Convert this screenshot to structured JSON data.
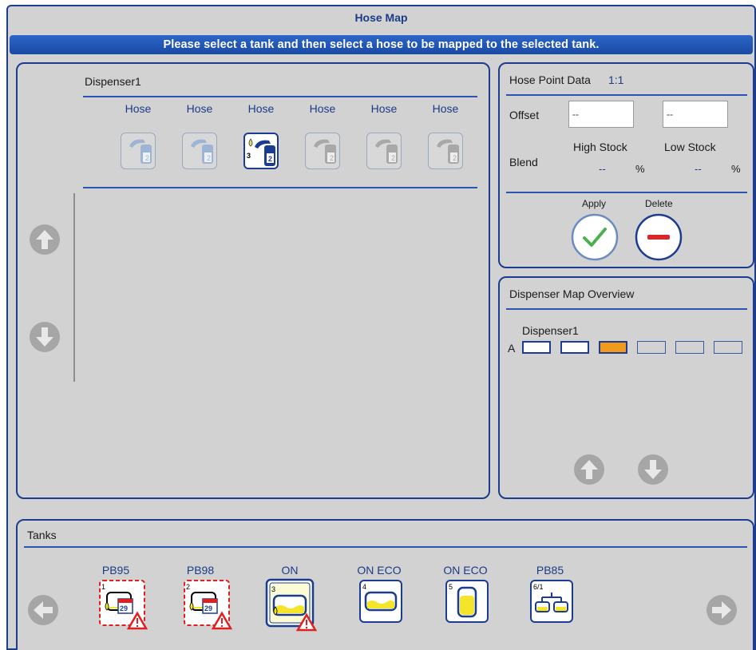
{
  "window": {
    "title": "Hose Map",
    "instruction": "Please select a tank and then select a hose to be mapped to the selected tank."
  },
  "dispenser_panel": {
    "dispenser_name": "Dispenser1",
    "hoses": [
      {
        "label": "Hose",
        "selected": false
      },
      {
        "label": "Hose",
        "selected": false
      },
      {
        "label": "Hose",
        "selected": true,
        "tank_number": "3"
      },
      {
        "label": "Hose",
        "selected": false
      },
      {
        "label": "Hose",
        "selected": false
      },
      {
        "label": "Hose",
        "selected": false
      }
    ]
  },
  "hose_point_data": {
    "title": "Hose Point Data",
    "value": "1:1",
    "offset_label": "Offset",
    "offset_value_1": "--",
    "offset_value_2": "--",
    "blend_label": "Blend",
    "high_stock_label": "High Stock",
    "low_stock_label": "Low Stock",
    "high_stock_value": "--",
    "low_stock_value": "--",
    "percent": "%",
    "apply_label": "Apply",
    "delete_label": "Delete"
  },
  "dispenser_map_overview": {
    "title": "Dispenser Map Overview",
    "dispenser_name": "Dispenser1",
    "row_label": "A",
    "slots": [
      "mapped",
      "mapped",
      "selected",
      "empty",
      "empty",
      "empty"
    ]
  },
  "tanks": {
    "title": "Tanks",
    "items": [
      {
        "label": "PB95",
        "number": "1",
        "date": "29",
        "warning": true
      },
      {
        "label": "PB98",
        "number": "2",
        "date": "29",
        "warning": true
      },
      {
        "label": "ON",
        "number": "3",
        "warning": true,
        "selected": true
      },
      {
        "label": "ON  ECO",
        "number": "4"
      },
      {
        "label": "ON  ECO",
        "number": "5"
      },
      {
        "label": "PB85",
        "number": "6/1"
      }
    ]
  },
  "colors": {
    "accent": "#1c3d8f",
    "banner": "#2c66c8",
    "background": "#d2d2d2",
    "selected_slot": "#f29a1c",
    "warning": "#e02020",
    "fuel": "#f5e52a",
    "apply": "#4caf50",
    "delete": "#d9262b"
  }
}
